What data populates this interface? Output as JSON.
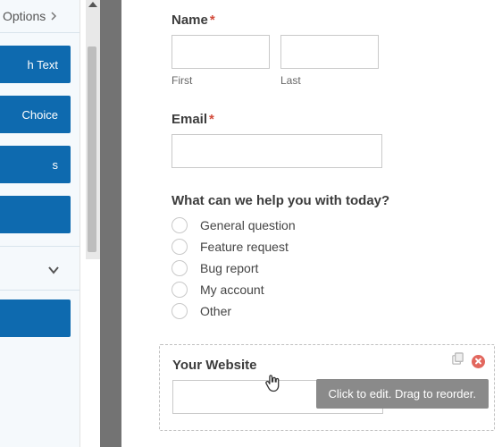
{
  "sidebar": {
    "options_label": "Options",
    "buttons": [
      {
        "label": "h Text"
      },
      {
        "label": "Choice"
      },
      {
        "label": "s"
      },
      {
        "label": ""
      }
    ],
    "button2": ""
  },
  "form": {
    "name": {
      "label": "Name",
      "required": "*",
      "sub_first": "First",
      "sub_last": "Last"
    },
    "email": {
      "label": "Email",
      "required": "*"
    },
    "help": {
      "label": "What can we help you with today?",
      "options": [
        "General question",
        "Feature request",
        "Bug report",
        "My account",
        "Other"
      ]
    },
    "website": {
      "label": "Your Website",
      "tooltip": "Click to edit. Drag to reorder."
    }
  }
}
